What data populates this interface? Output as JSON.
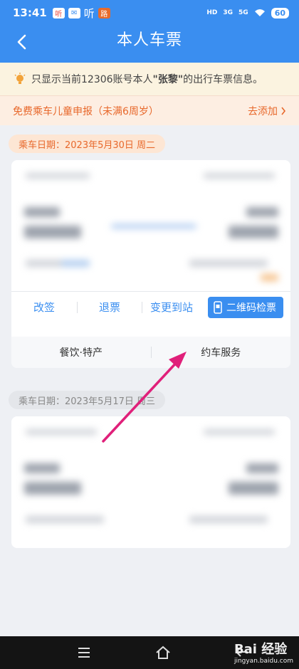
{
  "status": {
    "time": "13:41",
    "apps": [
      "听",
      "✉",
      "听",
      "路"
    ],
    "net": [
      "HD",
      "3G",
      "5G"
    ],
    "battery": "60"
  },
  "header": {
    "title": "本人车票"
  },
  "notice": {
    "prefix": "只显示当前12306账号本人",
    "name": "\"张黎\"",
    "suffix": "的出行车票信息。"
  },
  "child": {
    "label": "免费乘车儿童申报（未满6周岁）",
    "action": "去添加"
  },
  "trips": [
    {
      "date": "乘车日期：2023年5月30日 周二"
    },
    {
      "date": "乘车日期：2023年5月17日 周三"
    }
  ],
  "ticket_actions": {
    "change": "改签",
    "refund": "退票",
    "change_station": "变更到站",
    "qr_check": "二维码检票"
  },
  "services": {
    "food": "餐饮·特产",
    "car": "约车服务"
  },
  "watermark": {
    "brand": "Bai 经验",
    "url": "jingyan.baidu.com"
  },
  "colors": {
    "primary": "#3a8ef0",
    "accent": "#e8682b",
    "annotation_arrow": "#e0207a"
  }
}
